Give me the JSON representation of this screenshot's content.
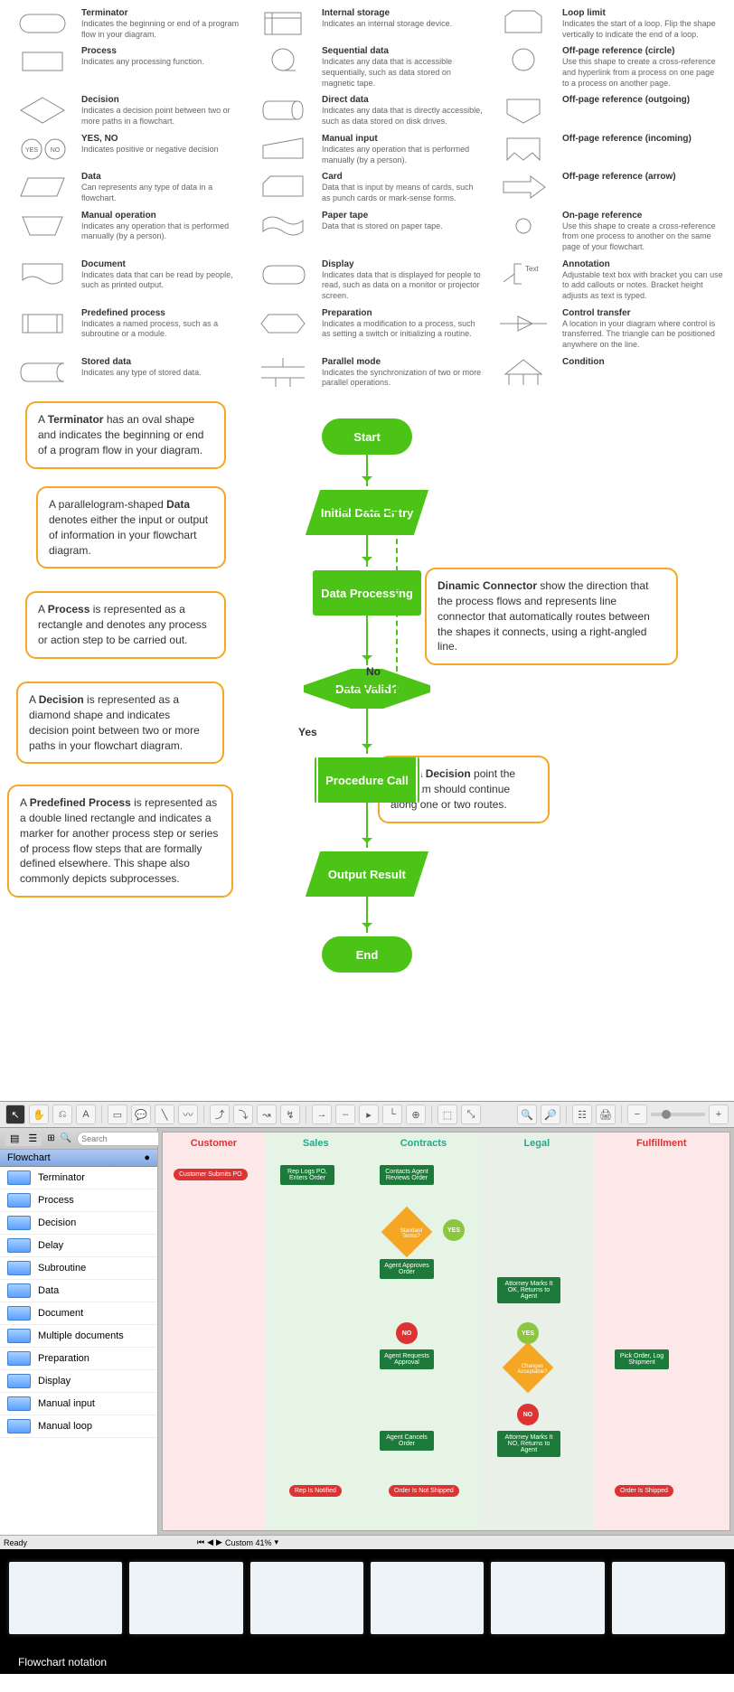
{
  "legend": [
    {
      "title": "Terminator",
      "desc": "Indicates the beginning or end of a program flow in your diagram.",
      "shape": "terminator"
    },
    {
      "title": "Internal storage",
      "desc": "Indicates an internal storage device.",
      "shape": "internal"
    },
    {
      "title": "Loop limit",
      "desc": "Indicates the start of a loop. Flip the shape vertically to indicate the end of a loop.",
      "shape": "loop"
    },
    {
      "title": "Process",
      "desc": "Indicates any processing function.",
      "shape": "process"
    },
    {
      "title": "Sequential data",
      "desc": "Indicates any data that is accessible sequentially, such as data stored on magnetic tape.",
      "shape": "seqdata"
    },
    {
      "title": "Off-page reference (circle)",
      "desc": "Use this shape to create a cross-reference and hyperlink from a process on one page to a process on another page.",
      "shape": "circleref"
    },
    {
      "title": "Decision",
      "desc": "Indicates a decision point between two or more paths in a flowchart.",
      "shape": "decision"
    },
    {
      "title": "Direct data",
      "desc": "Indicates any data that is directly accessible, such as data stored on disk drives.",
      "shape": "directdata"
    },
    {
      "title": "Off-page reference (outgoing)",
      "desc": "",
      "shape": "offout"
    },
    {
      "title": "YES, NO",
      "desc": "Indicates positive or negative decision",
      "shape": "yesno"
    },
    {
      "title": "Manual input",
      "desc": "Indicates any operation that is performed manually (by a person).",
      "shape": "manualinput"
    },
    {
      "title": "Off-page reference (incoming)",
      "desc": "",
      "shape": "offin"
    },
    {
      "title": "Data",
      "desc": "Can represents any type of data in a flowchart.",
      "shape": "data"
    },
    {
      "title": "Card",
      "desc": "Data that is input by means of cards, such as punch cards or mark-sense forms.",
      "shape": "card"
    },
    {
      "title": "Off-page reference (arrow)",
      "desc": "",
      "shape": "offarrow"
    },
    {
      "title": "Manual operation",
      "desc": "Indicates any operation that is performed manually (by a person).",
      "shape": "manop"
    },
    {
      "title": "Paper tape",
      "desc": "Data that is stored on paper tape.",
      "shape": "papertape"
    },
    {
      "title": "On-page reference",
      "desc": "Use this shape to create a cross-reference from one process to another on the same page of your flowchart.",
      "shape": "onpage"
    },
    {
      "title": "Document",
      "desc": "Indicates data that can be read by people, such as printed output.",
      "shape": "document"
    },
    {
      "title": "Display",
      "desc": "Indicates data that is displayed for people to read, such as data on a monitor or projector screen.",
      "shape": "display"
    },
    {
      "title": "Annotation",
      "desc": "Adjustable text box with bracket you can use to add callouts or notes. Bracket height adjusts as text is typed.",
      "shape": "annotation"
    },
    {
      "title": "Predefined process",
      "desc": "Indicates a named process, such as a subroutine or a module.",
      "shape": "predef"
    },
    {
      "title": "Preparation",
      "desc": "Indicates a modification to a process, such as setting a switch or initializing a routine.",
      "shape": "prep"
    },
    {
      "title": "Control transfer",
      "desc": "A location in your diagram where control is transferred. The triangle can be positioned anywhere on the line.",
      "shape": "control"
    },
    {
      "title": "Stored data",
      "desc": "Indicates any type of stored data.",
      "shape": "stored"
    },
    {
      "title": "Parallel mode",
      "desc": "Indicates the synchronization of two or more parallel operations.",
      "shape": "parallel"
    },
    {
      "title": "Condition",
      "desc": "",
      "shape": "condition"
    }
  ],
  "callouts": {
    "terminator": "A <b>Terminator</b> has an oval shape and indicates the beginning or end of a program flow in your diagram.",
    "data": "A parallelogram-shaped <b>Data</b> denotes either the input or output of information in your flowchart diagram.",
    "process": "A <b>Process</b> is represented as a rectangle and denotes any process or action step to be carried out.",
    "decision": "A <b>Decision</b> is represented as a diamond shape and indicates decision point between two or more paths in your flowchart diagram.",
    "predef": "A <b>Predefined Process</b> is represented as a double lined rectangle and indicates a marker for another process step or series of process flow steps that are formally defined elsewhere. This shape also commonly depicts subprocesses.",
    "connector": "<b>Dinamic Connector</b> show the direction that the process flows and represents line connector that automatically routes between the shapes it connects, using a right-angled line.",
    "after": "After a <b>Decision</b> point the program should continue along one or two routes."
  },
  "nodes": {
    "start": "Start",
    "initial": "Initial Data Entry",
    "proc": "Data Processing",
    "valid": "Data Valid?",
    "call": "Procedure Call",
    "output": "Output Result",
    "end": "End",
    "yes": "Yes",
    "no": "No"
  },
  "palette": {
    "search_ph": "Search",
    "section": "Flowchart",
    "items": [
      "Terminator",
      "Process",
      "Decision",
      "Delay",
      "Subroutine",
      "Data",
      "Document",
      "Multiple documents",
      "Preparation",
      "Display",
      "Manual input",
      "Manual loop"
    ]
  },
  "swimlanes": [
    "Customer",
    "Sales",
    "Contracts",
    "Legal",
    "Fulfillment"
  ],
  "fc": {
    "cust_submit": "Customer Submits PO",
    "rep_logs": "Rep Logs PO, Enters Order",
    "contacts": "Contacts Agent Reviews Order",
    "std_terms": "Standard Terms?",
    "approves": "Agent Approves Order",
    "attorney1": "Attorney Marks It OK, Returns to Agent",
    "requests": "Agent Requests Approval",
    "changes": "Changes Acceptable?",
    "pick": "Pick Order, Log Shipment",
    "cancels": "Agent Cancels Order",
    "attorney2": "Attorney Marks It NO, Returns to Agent",
    "notified": "Rep Is Notified",
    "notship": "Order Is Not Shipped",
    "shipped": "Order Is Shipped",
    "yes": "YES",
    "no": "NO"
  },
  "status": {
    "ready": "Ready",
    "zoom": "Custom 41%"
  },
  "thumb_label": "Flowchart notation",
  "annotation_text": "Text"
}
